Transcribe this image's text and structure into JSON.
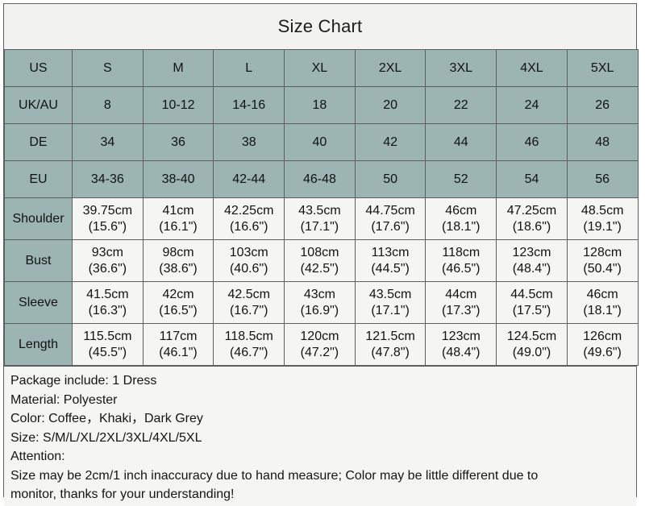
{
  "title": "Size Chart",
  "colors": {
    "header_teal": "#9cb4b2",
    "cell_light": "#f5f5f3",
    "panel_bg": "#f2f2f0",
    "border": "#5b5f5e",
    "text": "#121212"
  },
  "table": {
    "head_rows": [
      {
        "label": "US",
        "values": [
          "S",
          "M",
          "L",
          "XL",
          "2XL",
          "3XL",
          "4XL",
          "5XL"
        ]
      },
      {
        "label": "UK/AU",
        "values": [
          "8",
          "10-12",
          "14-16",
          "18",
          "20",
          "22",
          "24",
          "26"
        ]
      },
      {
        "label": "DE",
        "values": [
          "34",
          "36",
          "38",
          "40",
          "42",
          "44",
          "46",
          "48"
        ]
      },
      {
        "label": "EU",
        "values": [
          "34-36",
          "38-40",
          "42-44",
          "46-48",
          "50",
          "52",
          "54",
          "56"
        ]
      }
    ],
    "meas_rows": [
      {
        "label": "Shoulder",
        "cm": [
          "39.75cm",
          "41cm",
          "42.25cm",
          "43.5cm",
          "44.75cm",
          "46cm",
          "47.25cm",
          "48.5cm"
        ],
        "inch": [
          "(15.6\")",
          "(16.1\")",
          "(16.6\")",
          "(17.1\")",
          "(17.6\")",
          "(18.1\")",
          "(18.6\")",
          "(19.1\")"
        ]
      },
      {
        "label": "Bust",
        "cm": [
          "93cm",
          "98cm",
          "103cm",
          "108cm",
          "113cm",
          "118cm",
          "123cm",
          "128cm"
        ],
        "inch": [
          "(36.6\")",
          "(38.6\")",
          "(40.6\")",
          "(42.5\")",
          "(44.5\")",
          "(46.5\")",
          "(48.4\")",
          "(50.4\")"
        ]
      },
      {
        "label": "Sleeve",
        "cm": [
          "41.5cm",
          "42cm",
          "42.5cm",
          "43cm",
          "43.5cm",
          "44cm",
          "44.5cm",
          "46cm"
        ],
        "inch": [
          "(16.3\")",
          "(16.5\")",
          "(16.7\")",
          "(16.9\")",
          "(17.1\")",
          "(17.3\")",
          "(17.5\")",
          "(18.1\")"
        ]
      },
      {
        "label": "Length",
        "cm": [
          "115.5cm",
          "117cm",
          "118.5cm",
          "120cm",
          "121.5cm",
          "123cm",
          "124.5cm",
          "126cm"
        ],
        "inch": [
          "(45.5\")",
          "(46.1\")",
          "(46.7\")",
          "(47.2\")",
          "(47.8\")",
          "(48.4\")",
          "(49.0\")",
          "(49.6\")"
        ]
      }
    ]
  },
  "footer": {
    "lines": [
      "Package include: 1 Dress",
      "Material: Polyester",
      "Color: Coffee，Khaki，Dark Grey",
      "Size: S/M/L/XL/2XL/3XL/4XL/5XL",
      "Attention:",
      "Size may be 2cm/1 inch inaccuracy due to hand measure; Color may be little different due to",
      "monitor, thanks for your understanding!"
    ]
  }
}
